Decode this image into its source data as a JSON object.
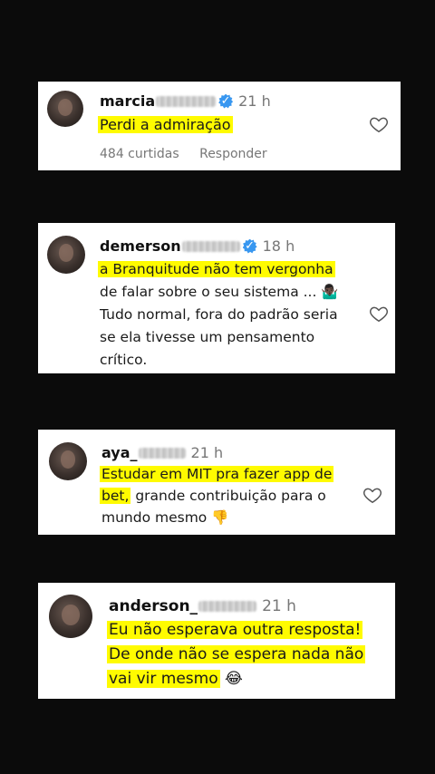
{
  "comments": [
    {
      "username": "marcia",
      "time": "21 h",
      "lines": [
        "Perdi a admiração"
      ],
      "likes": "484 curtidas",
      "reply": "Responder"
    },
    {
      "username": "demerson",
      "time": "18 h",
      "lines": [
        "a Branquitude não tem vergonha",
        "de falar sobre o seu sistema ... 🤷🏿‍♂️",
        "Tudo normal, fora do padrão seria",
        "se ela tivesse um pensamento",
        "crítico."
      ]
    },
    {
      "username": "aya_",
      "time": "21 h",
      "lines": [
        "Estudar em MIT pra fazer app de",
        "bet,",
        " grande contribuição para o",
        "mundo mesmo 👎"
      ]
    },
    {
      "username": "anderson_",
      "time": "21 h",
      "lines": [
        "Eu não esperava outra resposta!",
        "De onde não se espera nada não",
        "vai vir mesmo",
        " 😂"
      ]
    }
  ],
  "colors": {
    "highlight": "#fffb00",
    "verified": "#3897f0"
  },
  "icons": {
    "verified": "verified-badge-icon",
    "heart": "heart-outline-icon"
  }
}
